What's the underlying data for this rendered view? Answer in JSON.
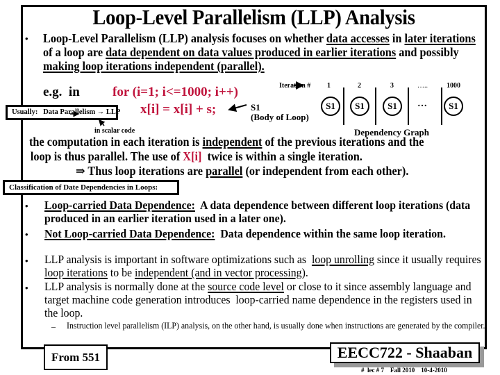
{
  "slide": {
    "title": "Loop-Level Parallelism (LLP) Analysis",
    "intro": {
      "bullet": "•",
      "parts": [
        {
          "text": "Loop-Level Parallelism (LLP) analysis focuses on whether ",
          "u": false
        },
        {
          "text": "data accesses",
          "u": true
        },
        {
          "text": " in ",
          "u": false
        },
        {
          "text": "later iterations",
          "u": true
        },
        {
          "text": " of a loop are ",
          "u": false
        },
        {
          "text": "data dependent on data values produced in earlier iterations",
          "u": true
        },
        {
          "text": " and possibly ",
          "u": false
        },
        {
          "text": "making loop iterations independent (parallel).",
          "u": true
        }
      ]
    },
    "example": {
      "eg_label": "e.g.  in",
      "code_line1": "for (i=1; i<=1000; i++)",
      "code_line2": "x[i] = x[i] + s;",
      "s1_label": "S1",
      "s1_caption": "(Body of Loop)",
      "usually_box": "Usually:   Data Parallelism → LLP",
      "scalar_note": "in scalar code"
    },
    "dependency_graph": {
      "iteration_label": "Iteration #",
      "iterations": [
        "1",
        "2",
        "3",
        "…..",
        "1000"
      ],
      "nodes": [
        "S1",
        "S1",
        "S1",
        "…",
        "S1"
      ],
      "caption": "Dependency Graph"
    },
    "computation": {
      "line1_a": "the computation in each iteration is ",
      "line1_u": "independent",
      "line1_b": " of the  previous iterations and the",
      "line2_a": "loop is thus parallel. The use of ",
      "line2_red": "X[i]",
      "line2_b": "  twice is within a single iteration.",
      "line3_a": "⇒ Thus loop iterations are ",
      "line3_u": "parallel",
      "line3_b": " (or independent from each other)."
    },
    "classification_box": "Classification of Date Dependencies in Loops:",
    "items": [
      {
        "term": "Loop-carried Data Dependence:",
        "text": "  A data dependence between different loop iterations (data produced in an earlier iteration used in a later one)."
      },
      {
        "term": "Not Loop-carried Data Dependence:",
        "text": "  Data dependence within the same loop iteration."
      }
    ],
    "llp_item1": {
      "a": "LLP analysis is important in software optimizations such as  ",
      "u1": "loop unrolling",
      "b": " since it usually requires ",
      "u2": "loop iterations",
      "c": " to be ",
      "u3": "independent (and in vector processing",
      "d": ")."
    },
    "llp_item2": {
      "a": "LLP analysis is normally done at the ",
      "u1": "source code level",
      "b": " or close to it since assembly language and target machine code generation introduces  loop-carried name dependence in the registers used in the loop."
    },
    "sub_item": {
      "dash": "–",
      "text": "Instruction level parallelism (ILP) analysis, on the other hand, is usually done when instructions are generated by the compiler."
    },
    "from_box": "From 551",
    "course_box": "EECC722 - Shaaban",
    "footer": "#  lec # 7    Fall 2010    10-4-2010"
  },
  "colors": {
    "code_red": "#c0143c",
    "text": "#000000",
    "shadow": "#999999"
  }
}
